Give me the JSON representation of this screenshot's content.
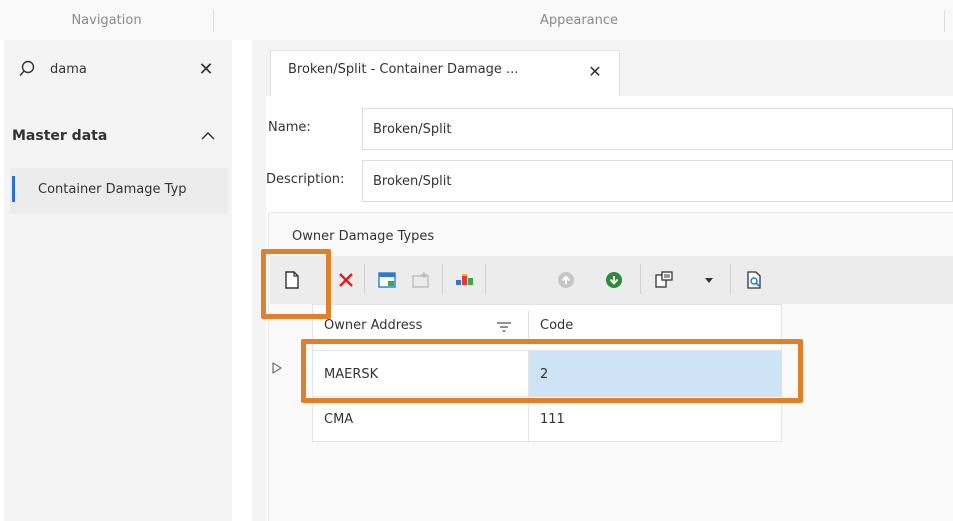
{
  "header": {
    "navigation_title": "Navigation",
    "appearance_title": "Appearance"
  },
  "navigation": {
    "search_value": "dama",
    "group_title": "Master data",
    "items": [
      {
        "label": "Container Damage Typ"
      }
    ]
  },
  "tab": {
    "label": "Broken/Split - Container Damage ..."
  },
  "form": {
    "name_label": "Name:",
    "name_value": "Broken/Split",
    "description_label": "Description:",
    "description_value": "Broken/Split"
  },
  "owner_damage_types": {
    "title": "Owner Damage Types",
    "columns": [
      "Owner Address",
      "Code"
    ],
    "rows": [
      {
        "owner": "MAERSK",
        "code": "2"
      },
      {
        "owner": "CMA",
        "code": "111"
      }
    ]
  },
  "colors": {
    "highlight": "#e07f2c",
    "accent": "#2b6fd6",
    "selected_cell": "#cfe3f7"
  }
}
